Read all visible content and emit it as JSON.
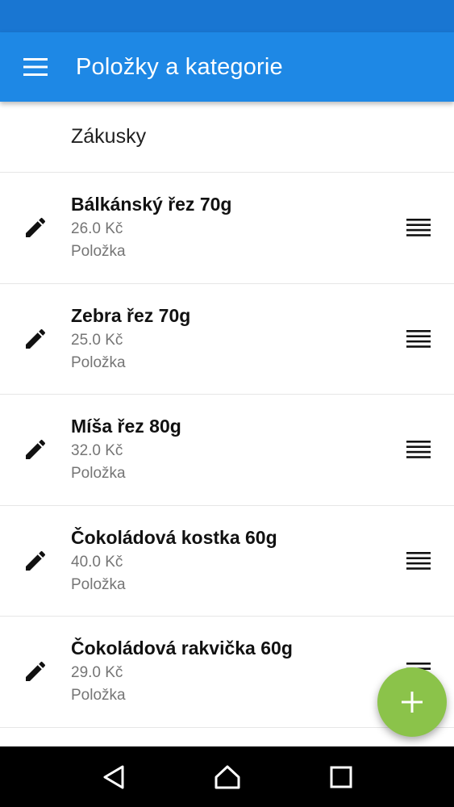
{
  "app_bar": {
    "title": "Položky a kategorie",
    "menu_icon": "hamburger-menu-icon",
    "background": "#1e88e5"
  },
  "list": {
    "category": "Zákusky",
    "items": [
      {
        "name": "Bálkánský řez 70g",
        "price": "26.0 Kč",
        "type": "Položka"
      },
      {
        "name": "Zebra řez 70g",
        "price": "25.0 Kč",
        "type": "Položka"
      },
      {
        "name": "Míša řez 80g",
        "price": "32.0 Kč",
        "type": "Položka"
      },
      {
        "name": "Čokoládová kostka 60g",
        "price": "40.0 Kč",
        "type": "Položka"
      },
      {
        "name": "Čokoládová rakvička 60g",
        "price": "29.0 Kč",
        "type": "Položka"
      }
    ]
  },
  "fab": {
    "icon": "plus-icon",
    "color": "#8bc34a"
  },
  "nav_bar": {
    "icons": [
      "back-icon",
      "home-icon",
      "recents-icon"
    ]
  }
}
